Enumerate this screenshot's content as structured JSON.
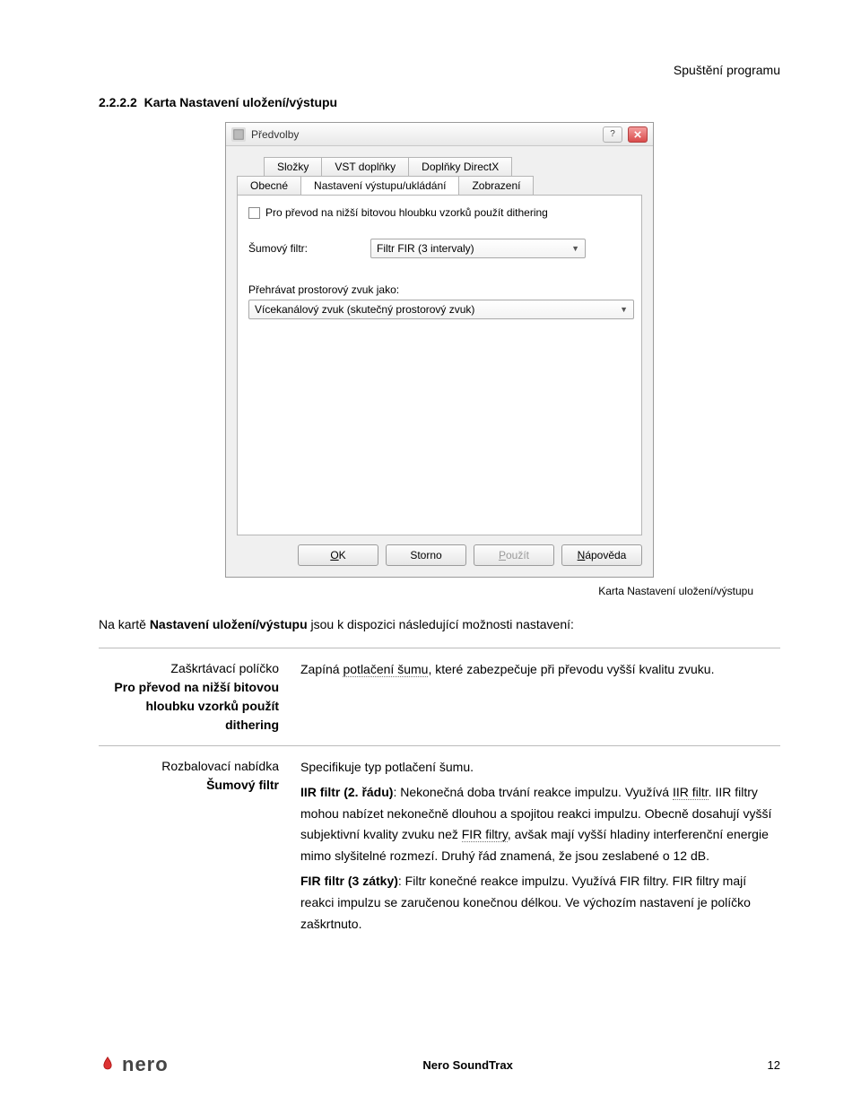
{
  "header": {
    "chapter_path": "Spuštění programu"
  },
  "section": {
    "number": "2.2.2.2",
    "title": "Karta Nastavení uložení/výstupu"
  },
  "dialog": {
    "title": "Předvolby",
    "tabs_top": [
      "Složky",
      "VST doplňky",
      "Doplňky DirectX"
    ],
    "tabs_bottom": [
      "Obecné",
      "Nastavení výstupu/ukládání",
      "Zobrazení"
    ],
    "active_tab": "Nastavení výstupu/ukládání",
    "checkbox_label": "Pro převod na nižší bitovou hloubku vzorků použít dithering",
    "noise_label": "Šumový filtr:",
    "noise_value": "Filtr FIR (3 intervaly)",
    "play_label": "Přehrávat prostorový zvuk jako:",
    "play_value": "Vícekanálový zvuk (skutečný prostorový zvuk)",
    "buttons": {
      "ok": "OK",
      "cancel": "Storno",
      "apply": "Použít",
      "help": "Nápověda"
    }
  },
  "caption": "Karta Nastavení uložení/výstupu",
  "intro_prefix": "Na kartě ",
  "intro_bold": "Nastavení uložení/výstupu",
  "intro_suffix": " jsou k dispozici následující možnosti nastavení:",
  "rows": [
    {
      "term_lead": "Zaškrtávací políčko",
      "term_bold": "Pro převod na nižší bitovou hloubku vzorků použít dithering",
      "desc_plain_before": "Zapíná ",
      "dotted1": "potlačení šumu",
      "desc_plain_mid": ", které zabezpečuje při převodu vyšší kvalitu zvuku."
    },
    {
      "term_lead": "Rozbalovací nabídka",
      "term_bold": "Šumový filtr",
      "p1": "Specifikuje typ potlačení šumu.",
      "p2_bold": "IIR filtr (2. řádu)",
      "p2_rest_a": ": Nekonečná doba trvání reakce impulzu. Využívá ",
      "p2_dotted_a": "IIR filtr",
      "p2_rest_b": ". IIR filtry mohou nabízet nekonečně dlouhou a spojitou reakci impulzu. Obecně dosahují vyšší subjektivní kvality zvuku než ",
      "p2_dotted_b": "FIR filtry",
      "p2_rest_c": ", avšak mají vyšší hladiny interferenční energie mimo slyšitelné rozmezí. Druhý řád znamená, že jsou zeslabené o 12 dB.",
      "p3_bold": "FIR filtr (3 zátky)",
      "p3_rest": ": Filtr konečné reakce impulzu. Využívá FIR filtry. FIR filtry mají reakci impulzu se zaručenou konečnou délkou. Ve výchozím nastavení je políčko zaškrtnuto."
    }
  ],
  "footer": {
    "product": "Nero SoundTrax",
    "page": "12",
    "brand": "nero"
  }
}
